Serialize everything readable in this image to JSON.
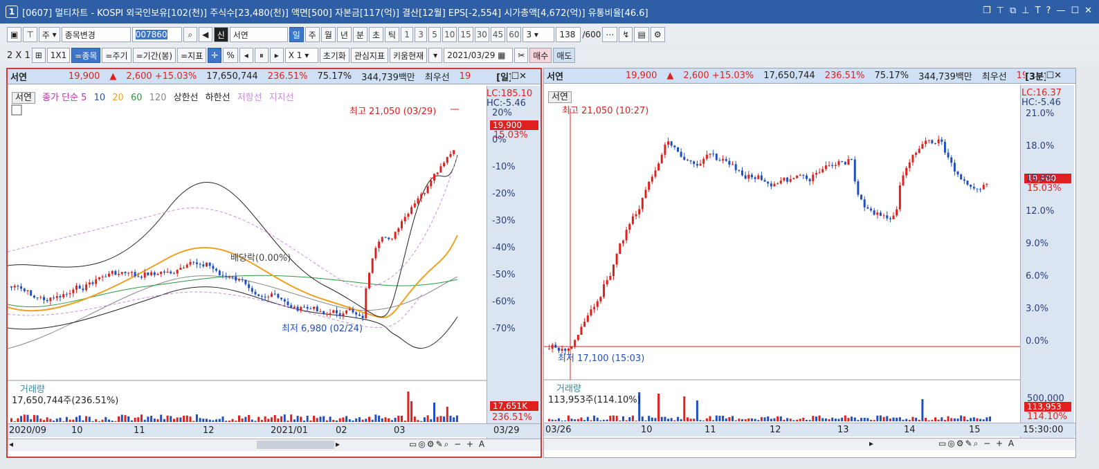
{
  "title": {
    "number": "1",
    "text": "[0607] 멀티차트 - KOSPI 외국인보유[102(천)] 주식수[23,480(천)] 액면[500] 자본금[117(억)] 결산[12월] EPS[-2,554] 시가총액[4,672(억)] 유통비율[46.6]"
  },
  "toolbar1": {
    "period_sel": "주",
    "change": "종목변경",
    "code": "007860",
    "new_badge": "신",
    "stock_name": "서연",
    "periods": [
      "일",
      "주",
      "월",
      "년",
      "분",
      "초",
      "틱"
    ],
    "nums": [
      "1",
      "3",
      "5",
      "10",
      "15",
      "30",
      "45",
      "60"
    ],
    "count_sel": "3",
    "count": "138",
    "total": "/600"
  },
  "toolbar2": {
    "layout": "2 X 1",
    "one": "1X1",
    "btn_stock": "=종목",
    "btn_period": "=주기",
    "btn_range": "=기간(봉)",
    "btn_indicator": "=지표",
    "pct": "%",
    "mult": "X 1",
    "init": "초기화",
    "interest": "관심지표",
    "kiwoom": "키움현재",
    "date": "2021/03/29",
    "buy": "매수",
    "sell": "매도"
  },
  "left": {
    "header": {
      "name": "서연",
      "price": "19,900",
      "arrow": "▲",
      "change": "2,600 +15.03%",
      "volume": "17,650,744",
      "vol_ratio": "236.51%",
      "rate": "75.17%",
      "amount": "344,739백만",
      "extra": "최우선",
      "extra2": "19",
      "period": "[일]"
    },
    "legend": {
      "name": "서연",
      "ma": "종가 단순 5",
      "ma10": "10",
      "ma20": "20",
      "ma60": "60",
      "ma120": "120",
      "upper": "상한선",
      "lower": "하한선",
      "resist": "저항선",
      "support": "지지선"
    },
    "lc": "LC:185.10",
    "hc": "HC:-5.46",
    "high": "최고 21,050 (03/29)",
    "low": "최저 6,980 (02/24)",
    "dividend": "배당락(0.00%)",
    "price_tag": "19,900",
    "pct_tag": "15.03%",
    "yticks": [
      "20%",
      "0%",
      "-10%",
      "-20%",
      "-30%",
      "-40%",
      "-50%",
      "-60%",
      "-70%"
    ],
    "volume_label": "거래량",
    "volume_text": "17,650,744주(236.51%)",
    "vol_tag": "17,651K",
    "vol_pct": "236.51%",
    "xticks": [
      "2020/09",
      "10",
      "11",
      "12",
      "2021/01",
      "02",
      "03",
      "03/29"
    ]
  },
  "right": {
    "header": {
      "name": "서연",
      "price": "19,900",
      "arrow": "▲",
      "change": "2,600 +15.03%",
      "volume": "17,650,744",
      "vol_ratio": "236.51%",
      "rate": "75.17%",
      "amount": "344,739백만",
      "extra": "최우선",
      "extra2": "19",
      "period": "[3분]"
    },
    "legend": {
      "name": "서연"
    },
    "lc": "LC:16.37",
    "hc": "HC:-5.46",
    "high": "최고 21,050 (10:27)",
    "low": "최저 17,100 (15:03)",
    "price_tag": "19,900",
    "pct_tag": "15.03%",
    "yticks": [
      "21.0%",
      "18.0%",
      "15.0%",
      "12.0%",
      "9.0%",
      "6.0%",
      "3.0%",
      "0.0%"
    ],
    "volume_label": "거래량",
    "volume_text": "113,953주(114.10%)",
    "vol_tick": "500,000",
    "vol_tag": "113,953",
    "vol_pct": "114.10%",
    "xticks": [
      "03/26",
      "10",
      "11",
      "12",
      "13",
      "14",
      "15",
      "15:30:00"
    ]
  },
  "colors": {
    "up": "#e0201e",
    "down": "#1f4fc2",
    "ma5": "#c02ea0",
    "ma20": "#f0a020",
    "ma60": "#2a9a3a"
  }
}
